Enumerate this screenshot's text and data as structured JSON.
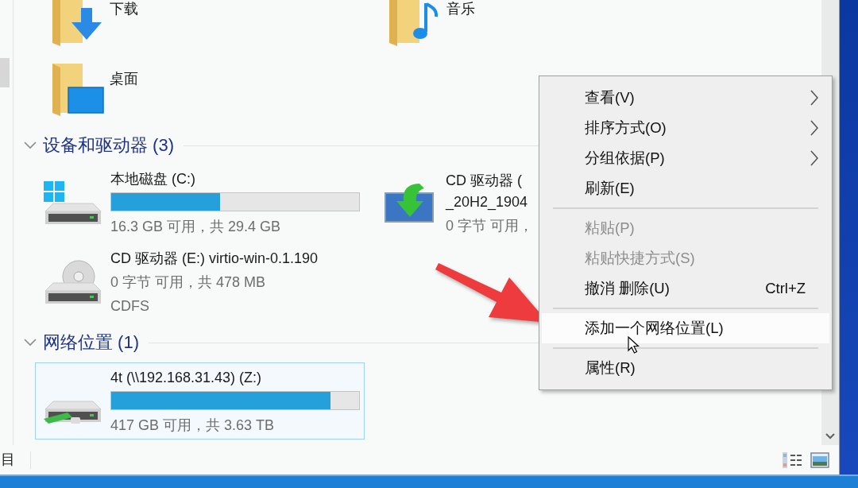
{
  "folders": [
    {
      "kind": "downloads",
      "name": "下载"
    },
    {
      "kind": "music",
      "name": "音乐"
    },
    {
      "kind": "desktop",
      "name": "桌面"
    }
  ],
  "groups": [
    {
      "title": "设备和驱动器 (3)",
      "expanded": true,
      "items": [
        {
          "kind": "local_disk",
          "name": "本地磁盘 (C:)",
          "level": 0.44,
          "detail": "16.3 GB 可用，共 29.4 GB",
          "selected": false
        },
        {
          "kind": "setup_disc",
          "name": "CD 驱动器 (",
          "name_continued": "_20H2_1904",
          "detail": "0 字节 可用，",
          "selected": false
        },
        {
          "kind": "cd_drive",
          "name": "CD 驱动器 (E:) virtio-win-0.1.190",
          "detail": "0 字节 可用，共 478 MB",
          "filesystem": "CDFS",
          "selected": false
        }
      ]
    },
    {
      "title": "网络位置 (1)",
      "expanded": true,
      "items": [
        {
          "kind": "network_drive",
          "name": "4t (\\\\192.168.31.43) (Z:)",
          "level": 0.885,
          "detail": "417 GB 可用，共 3.63 TB",
          "selected": true
        }
      ]
    }
  ],
  "context_menu": {
    "items": [
      {
        "kind": "item",
        "label": "查看(V)",
        "submenu": true,
        "disabled": false,
        "selected": false
      },
      {
        "kind": "item",
        "label": "排序方式(O)",
        "submenu": true,
        "disabled": false,
        "selected": false
      },
      {
        "kind": "item",
        "label": "分组依据(P)",
        "submenu": true,
        "disabled": false,
        "selected": false
      },
      {
        "kind": "item",
        "label": "刷新(E)",
        "submenu": false,
        "disabled": false,
        "selected": false
      },
      {
        "kind": "separator"
      },
      {
        "kind": "item",
        "label": "粘贴(P)",
        "submenu": false,
        "disabled": true,
        "selected": false
      },
      {
        "kind": "item",
        "label": "粘贴快捷方式(S)",
        "submenu": false,
        "disabled": true,
        "selected": false
      },
      {
        "kind": "item",
        "label": "撤消 删除(U)",
        "shortcut": "Ctrl+Z",
        "submenu": false,
        "disabled": false,
        "selected": false
      },
      {
        "kind": "separator"
      },
      {
        "kind": "item",
        "label": "添加一个网络位置(L)",
        "submenu": false,
        "disabled": false,
        "selected": true
      },
      {
        "kind": "separator"
      },
      {
        "kind": "item",
        "label": "属性(R)",
        "submenu": false,
        "disabled": false,
        "selected": false
      }
    ]
  },
  "status_bar": {
    "text": "目",
    "view_buttons": [
      {
        "kind": "details"
      },
      {
        "kind": "large_icons"
      }
    ]
  }
}
